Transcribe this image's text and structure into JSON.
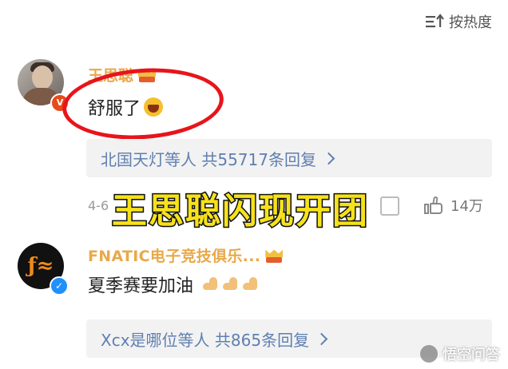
{
  "header": {
    "sort_label": "按热度"
  },
  "comments": [
    {
      "username": "王思聪",
      "text": "舒服了",
      "reply_summary": "北国天灯等人 共55717条回复",
      "timestamp": "4-6",
      "likes": "14万"
    },
    {
      "username": "FNATIC电子竞技俱乐...",
      "text": "夏季赛要加油",
      "reply_summary": "Xcx是哪位等人 共865条回复"
    }
  ],
  "overlay_caption": "王思聪闪现开团",
  "watermark": "悟空问答",
  "colors": {
    "username": "#e8a94a",
    "reply_link": "#5f7fb0",
    "highlight_circle": "#e8141b",
    "caption_fill": "#f6e21b"
  }
}
